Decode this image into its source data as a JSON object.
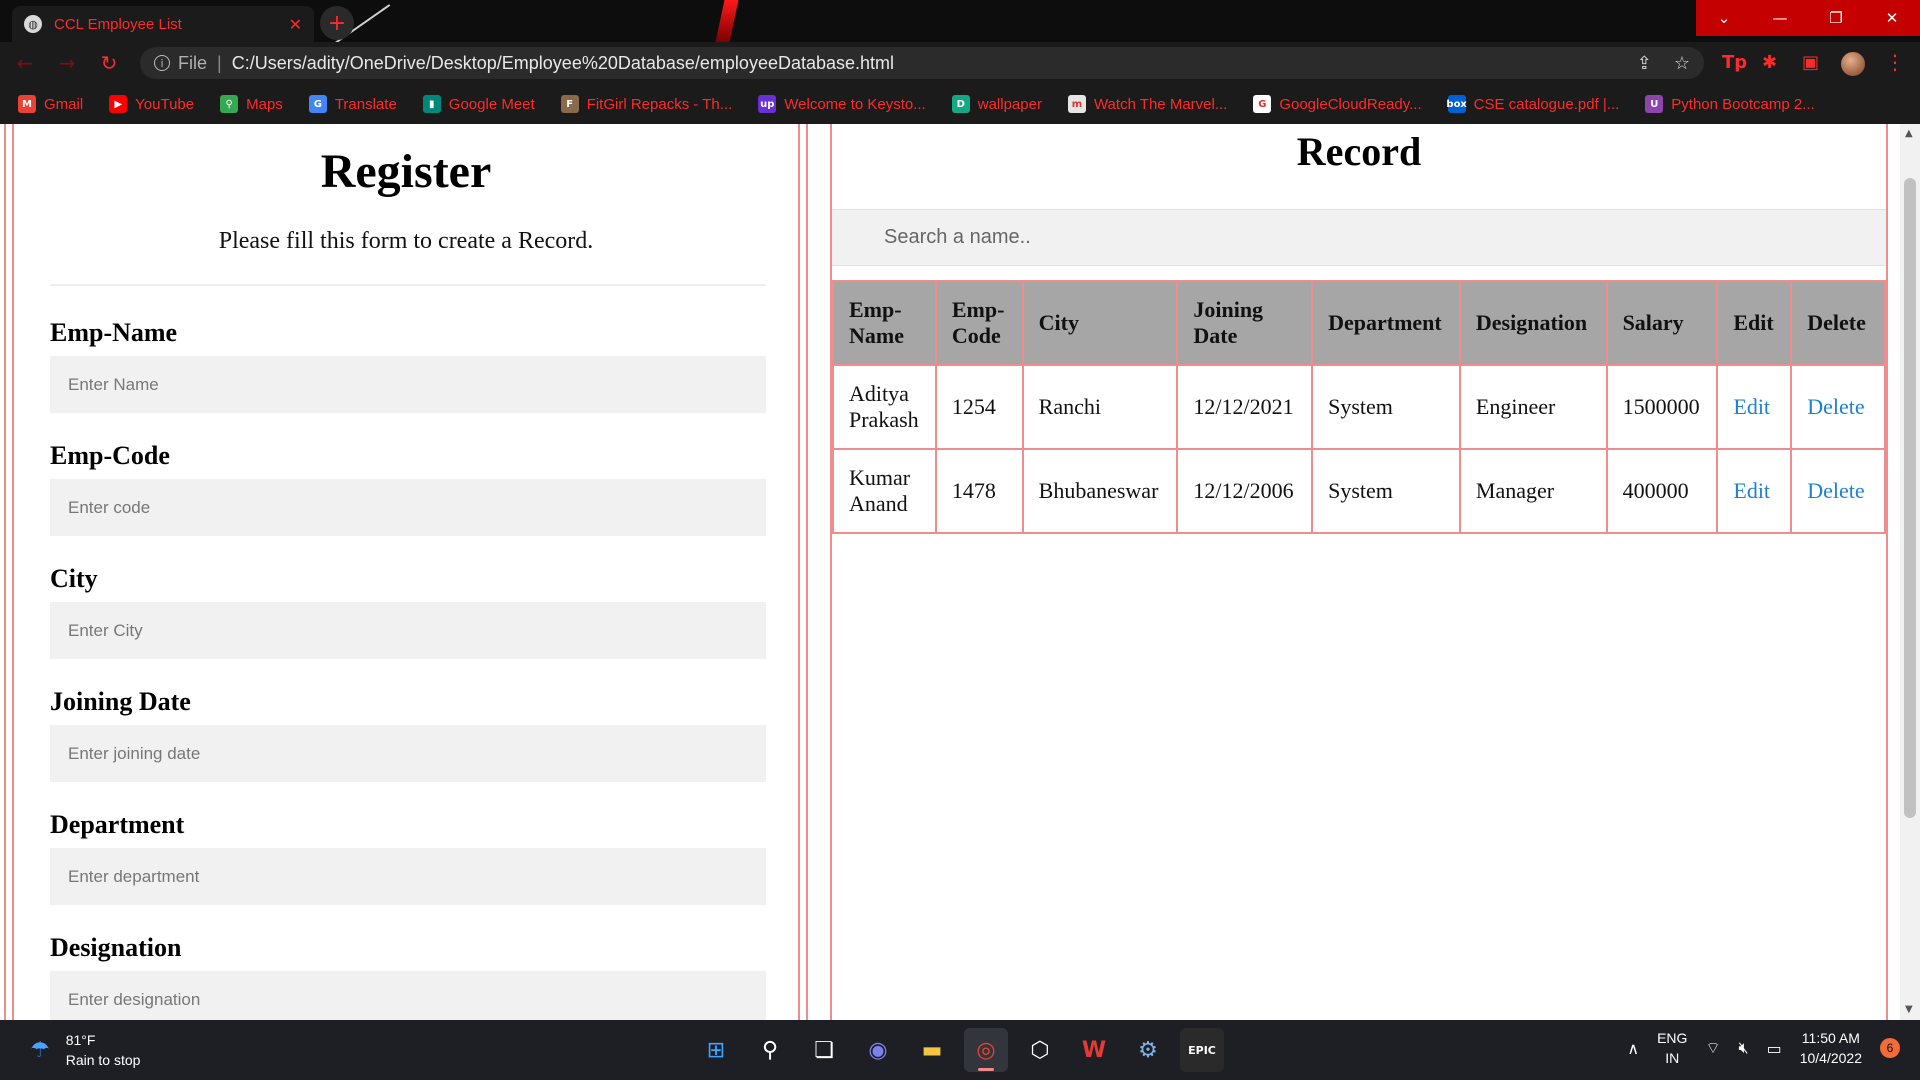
{
  "browser": {
    "tab_title": "CCL Employee List",
    "url_scheme": "File",
    "url": "C:/Users/adity/OneDrive/Desktop/Employee%20Database/employeeDatabase.html",
    "bookmarks": [
      {
        "label": "Gmail",
        "icon": "gmail-icon",
        "color": "#ea4335",
        "glyph": "M"
      },
      {
        "label": "YouTube",
        "icon": "youtube-icon",
        "color": "#ff0000",
        "glyph": "▶"
      },
      {
        "label": "Maps",
        "icon": "maps-icon",
        "color": "#34a853",
        "glyph": "⚲"
      },
      {
        "label": "Translate",
        "icon": "translate-icon",
        "color": "#4285f4",
        "glyph": "G"
      },
      {
        "label": "Google Meet",
        "icon": "meet-icon",
        "color": "#00897b",
        "glyph": "▮"
      },
      {
        "label": "FitGirl Repacks - Th...",
        "icon": "fitgirl-icon",
        "color": "#8a6a4a",
        "glyph": "F"
      },
      {
        "label": "Welcome to Keysto...",
        "icon": "upwork-icon",
        "color": "#6b2fd6",
        "glyph": "up"
      },
      {
        "label": "wallpaper",
        "icon": "wallpaper-icon",
        "color": "#14a884",
        "glyph": "D"
      },
      {
        "label": "Watch The Marvel...",
        "icon": "marvel-icon",
        "color": "#e5e5e5",
        "glyph": "m"
      },
      {
        "label": "GoogleCloudReady...",
        "icon": "google-icon",
        "color": "#ffffff",
        "glyph": "G"
      },
      {
        "label": "CSE catalogue.pdf |...",
        "icon": "box-icon",
        "color": "#0061d5",
        "glyph": "box"
      },
      {
        "label": "Python Bootcamp 2...",
        "icon": "python-bootcamp-icon",
        "color": "#8e44ad",
        "glyph": "U"
      }
    ]
  },
  "register": {
    "title": "Register",
    "subtitle": "Please fill this form to create a Record.",
    "fields": [
      {
        "label": "Emp-Name",
        "placeholder": "Enter Name"
      },
      {
        "label": "Emp-Code",
        "placeholder": "Enter code"
      },
      {
        "label": "City",
        "placeholder": "Enter City"
      },
      {
        "label": "Joining Date",
        "placeholder": "Enter joining date"
      },
      {
        "label": "Department",
        "placeholder": "Enter department"
      },
      {
        "label": "Designation",
        "placeholder": "Enter designation"
      }
    ]
  },
  "record": {
    "title": "Record",
    "search_placeholder": "Search a name..",
    "columns": [
      "Emp-Name",
      "Emp-Code",
      "City",
      "Joining Date",
      "Department",
      "Designation",
      "Salary",
      "Edit",
      "Delete"
    ],
    "rows": [
      {
        "name": "Aditya Prakash",
        "code": "1254",
        "city": "Ranchi",
        "date": "12/12/2021",
        "department": "System",
        "designation": "Engineer",
        "salary": "1500000",
        "edit": "Edit",
        "delete": "Delete"
      },
      {
        "name": "Kumar Anand",
        "code": "1478",
        "city": "Bhubaneswar",
        "date": "12/12/2006",
        "department": "System",
        "designation": "Manager",
        "salary": "400000",
        "edit": "Edit",
        "delete": "Delete"
      }
    ]
  },
  "taskbar": {
    "temperature": "81°F",
    "weather": "Rain to stop",
    "lang_top": "ENG",
    "lang_bottom": "IN",
    "time": "11:50 AM",
    "date": "10/4/2022",
    "notifications": "6"
  }
}
